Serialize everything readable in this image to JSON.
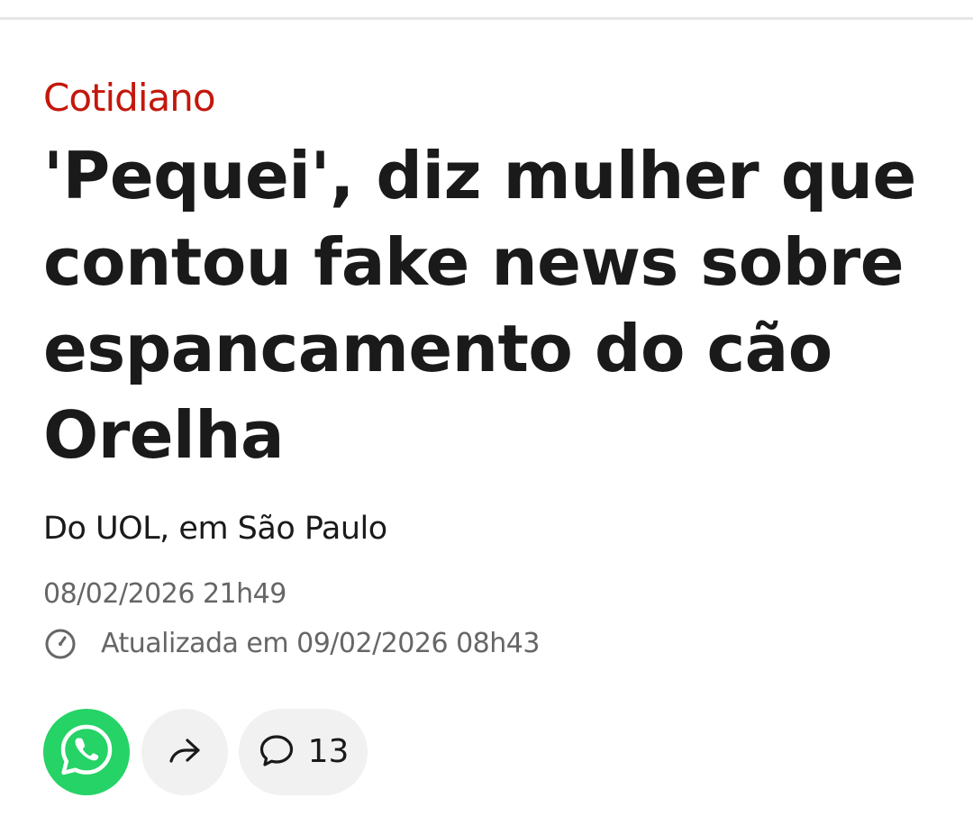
{
  "article": {
    "category": "Cotidiano",
    "headline_lines": [
      "'Pequei', diz mulher que",
      "contou fake news sobre",
      "espancamento do cão",
      "Orelha"
    ],
    "byline": "Do UOL, em São Paulo",
    "published": "08/02/2026 21h49",
    "updated": "Atualizada em 09/02/2026 08h43"
  },
  "actions": {
    "whatsapp_icon": "whatsapp-icon",
    "share_icon": "share-arrow-icon",
    "comment_icon": "comment-bubble-icon",
    "comment_count": "13"
  },
  "colors": {
    "category": "#c4170c",
    "whatsapp": "#25d366",
    "button_bg": "#f1f1f1",
    "text": "#1a1a1a",
    "muted": "#666666"
  }
}
